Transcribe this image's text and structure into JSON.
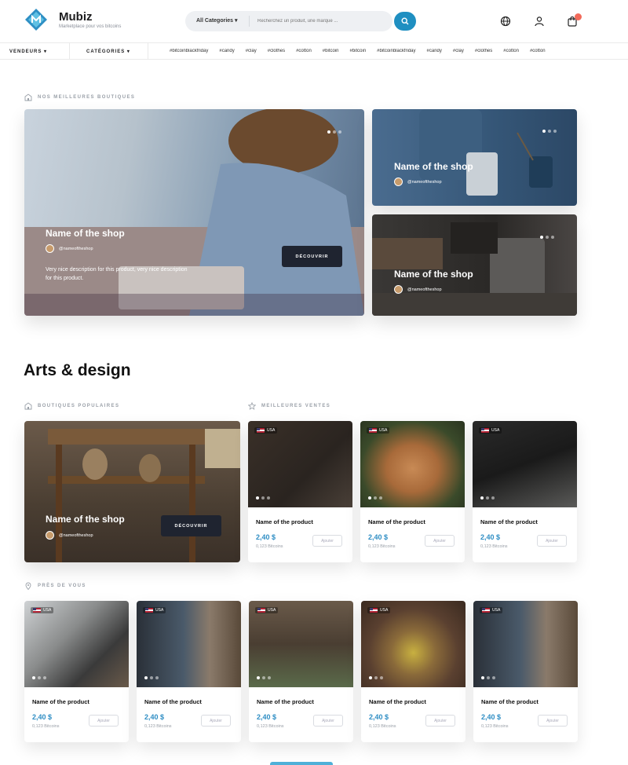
{
  "brand": {
    "name": "Mubiz",
    "tagline": "Marketplace pour vos bitcoins"
  },
  "search": {
    "category": "All Categories",
    "placeholder": "Recherchez un produit, une marque ..."
  },
  "subnav": {
    "vendeurs": "VENDEURS",
    "categories": "CATÉGORIES",
    "tags": [
      "#bitcoinblackfriday",
      "#candy",
      "#clay",
      "#clothes",
      "#cotton",
      "#bitcoin",
      "#bitcoin",
      "#bitcoinblackfriday",
      "#candy",
      "#clay",
      "#clothes",
      "#cotton",
      "#cotton"
    ]
  },
  "best_shops": {
    "label": "NOS MEILLEURES BOUTIQUES",
    "main": {
      "title": "Name of the shop",
      "handle": "@nameoftheshop",
      "desc": "Very nice description for this product, very nice description for this product.",
      "button": "DÉCOUVRIR"
    },
    "side1": {
      "title": "Name of the shop",
      "handle": "@nameoftheshop"
    },
    "side2": {
      "title": "Name of the shop",
      "handle": "@nameoftheshop"
    }
  },
  "arts": {
    "heading": "Arts & design",
    "popular_label": "BOUTIQUES POPULAIRES",
    "best_sales_label": "MEILLEURES VENTES",
    "popular_shop": {
      "title": "Name of the shop",
      "handle": "@nameoftheshop",
      "button": "DÉCOUVRIR"
    },
    "products": [
      {
        "name": "Name of the product",
        "price": "2,40 $",
        "btc": "0,123 Bitcoins",
        "add": "Ajouter",
        "country": "USA"
      },
      {
        "name": "Name of the product",
        "price": "2,40 $",
        "btc": "0,123 Bitcoins",
        "add": "Ajouter",
        "country": "USA"
      },
      {
        "name": "Name of the product",
        "price": "2,40 $",
        "btc": "0,123 Bitcoins",
        "add": "Ajouter",
        "country": "USA"
      }
    ]
  },
  "near": {
    "label": "PRÈS DE VOUS",
    "products": [
      {
        "name": "Name of the product",
        "price": "2,40 $",
        "btc": "0,123 Bitcoins",
        "add": "Ajouter",
        "country": "USA"
      },
      {
        "name": "Name of the product",
        "price": "2,40 $",
        "btc": "0,123 Bitcoins",
        "add": "Ajouter",
        "country": "USA"
      },
      {
        "name": "Name of the product",
        "price": "2,40 $",
        "btc": "0,123 Bitcoins",
        "add": "Ajouter",
        "country": "USA"
      },
      {
        "name": "Name of the product",
        "price": "2,40 $",
        "btc": "0,123 Bitcoins",
        "add": "Ajouter",
        "country": "USA"
      },
      {
        "name": "Name of the product",
        "price": "2,40 $",
        "btc": "0,123 Bitcoins",
        "add": "Ajouter",
        "country": "USA"
      }
    ]
  },
  "colors": {
    "accent": "#1f8fc1",
    "price": "#2f8ec4",
    "dark_button": "#1f2430",
    "cart_badge": "#f26b5b"
  },
  "icons": [
    "logo-icon",
    "search-icon",
    "globe-icon",
    "user-icon",
    "cart-icon",
    "store-icon",
    "star-icon",
    "location-icon"
  ]
}
